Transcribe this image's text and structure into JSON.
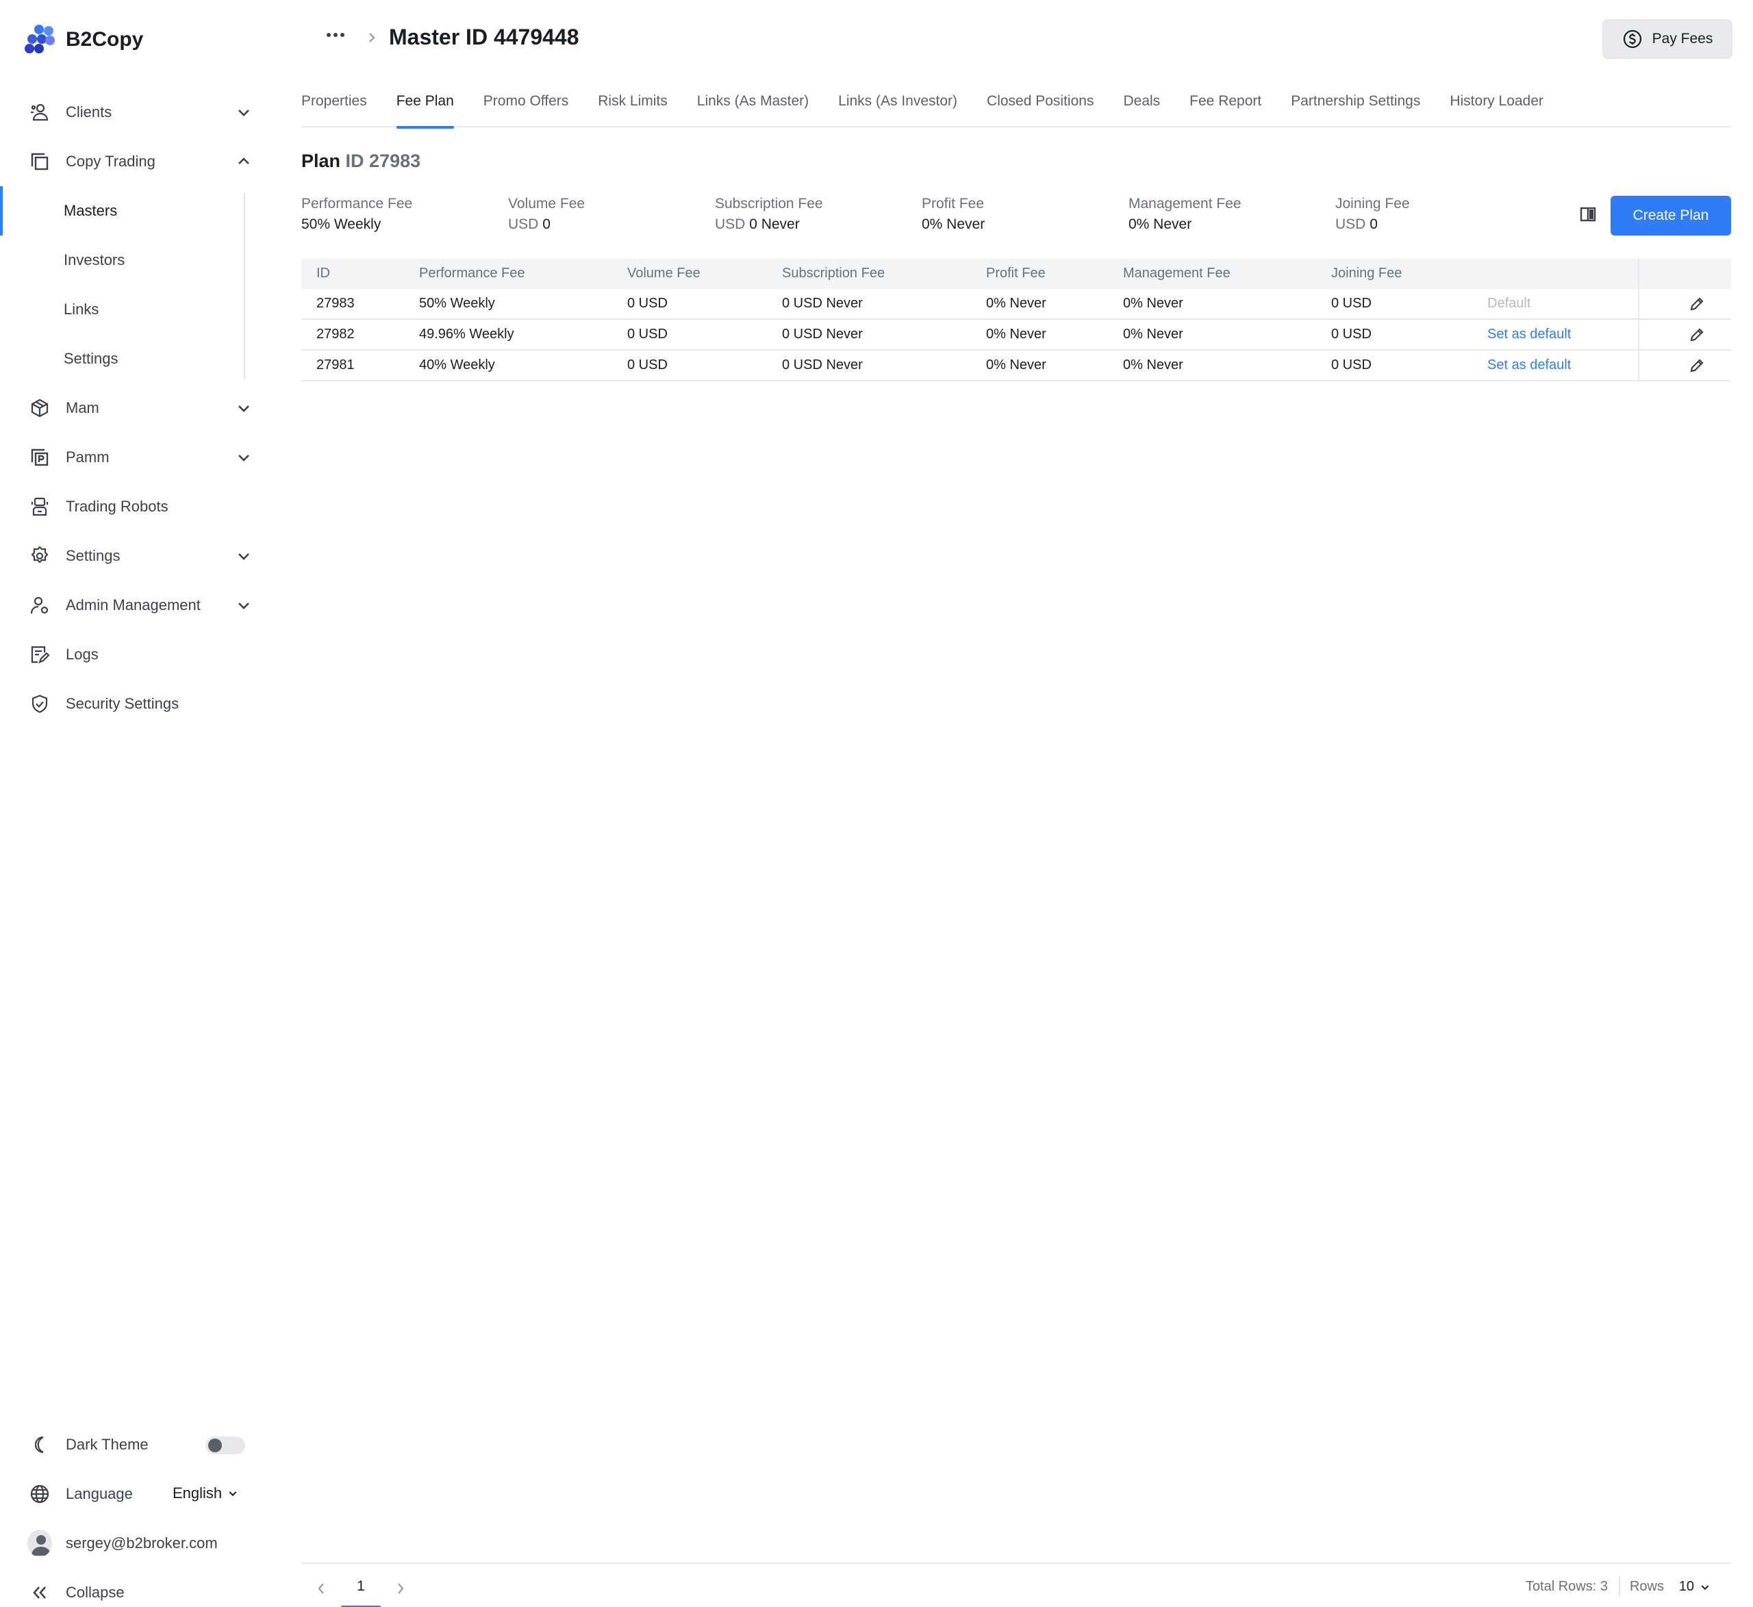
{
  "app": {
    "name": "B2Copy"
  },
  "sidebar": {
    "items": [
      {
        "label": "Clients",
        "icon": "clients-icon",
        "expandable": true,
        "expanded": false
      },
      {
        "label": "Copy Trading",
        "icon": "copy-trading-icon",
        "expandable": true,
        "expanded": true,
        "children": [
          {
            "label": "Masters",
            "active": true
          },
          {
            "label": "Investors"
          },
          {
            "label": "Links"
          },
          {
            "label": "Settings"
          }
        ]
      },
      {
        "label": "Mam",
        "icon": "cube-icon",
        "expandable": true,
        "expanded": false
      },
      {
        "label": "Pamm",
        "icon": "pamm-icon",
        "expandable": true,
        "expanded": false
      },
      {
        "label": "Trading Robots",
        "icon": "robot-icon",
        "expandable": false
      },
      {
        "label": "Settings",
        "icon": "gear-icon",
        "expandable": true,
        "expanded": false
      },
      {
        "label": "Admin Management",
        "icon": "admin-icon",
        "expandable": true,
        "expanded": false
      },
      {
        "label": "Logs",
        "icon": "logs-icon",
        "expandable": false
      },
      {
        "label": "Security Settings",
        "icon": "shield-icon",
        "expandable": false
      }
    ],
    "bottom": {
      "dark_theme_label": "Dark Theme",
      "dark_theme_on": false,
      "language_label": "Language",
      "language_value": "English",
      "user_email": "sergey@b2broker.com",
      "collapse_label": "Collapse"
    }
  },
  "header": {
    "title": "Master ID 4479448",
    "pay_fees_label": "Pay Fees"
  },
  "tabs": [
    {
      "label": "Properties"
    },
    {
      "label": "Fee Plan",
      "active": true
    },
    {
      "label": "Promo Offers"
    },
    {
      "label": "Risk Limits"
    },
    {
      "label": "Links (As Master)"
    },
    {
      "label": "Links (As Investor)"
    },
    {
      "label": "Closed Positions"
    },
    {
      "label": "Deals"
    },
    {
      "label": "Fee Report"
    },
    {
      "label": "Partnership Settings"
    },
    {
      "label": "History Loader"
    }
  ],
  "plan": {
    "title_prefix": "Plan",
    "title_id": "ID 27983",
    "summary": [
      {
        "key": "Performance Fee",
        "unit": "",
        "value": "50% Weekly"
      },
      {
        "key": "Volume Fee",
        "unit": "USD",
        "value": "0"
      },
      {
        "key": "Subscription Fee",
        "unit": "USD",
        "value": "0 Never"
      },
      {
        "key": "Profit Fee",
        "unit": "",
        "value": "0% Never"
      },
      {
        "key": "Management Fee",
        "unit": "",
        "value": "0% Never"
      },
      {
        "key": "Joining Fee",
        "unit": "USD",
        "value": "0"
      }
    ],
    "create_button": "Create Plan"
  },
  "table": {
    "columns": [
      "ID",
      "Performance Fee",
      "Volume Fee",
      "Subscription Fee",
      "Profit Fee",
      "Management Fee",
      "Joining Fee"
    ],
    "rows": [
      {
        "id": "27983",
        "performance": "50% Weekly",
        "volume": "0 USD",
        "subscription": "0 USD Never",
        "profit": "0% Never",
        "management": "0% Never",
        "joining": "0 USD",
        "action": "Default",
        "is_default": true
      },
      {
        "id": "27982",
        "performance": "49.96% Weekly",
        "volume": "0 USD",
        "subscription": "0 USD Never",
        "profit": "0% Never",
        "management": "0% Never",
        "joining": "0 USD",
        "action": "Set as default",
        "is_default": false
      },
      {
        "id": "27981",
        "performance": "40% Weekly",
        "volume": "0 USD",
        "subscription": "0 USD Never",
        "profit": "0% Never",
        "management": "0% Never",
        "joining": "0 USD",
        "action": "Set as default",
        "is_default": false
      }
    ]
  },
  "pagination": {
    "current_page": "1",
    "total_rows": "Total Rows: 3",
    "rows_label": "Rows",
    "rows_value": "10"
  },
  "colors": {
    "accent": "#2f7cf6",
    "muted_text": "#6b7078",
    "border": "#e6e8eb"
  }
}
